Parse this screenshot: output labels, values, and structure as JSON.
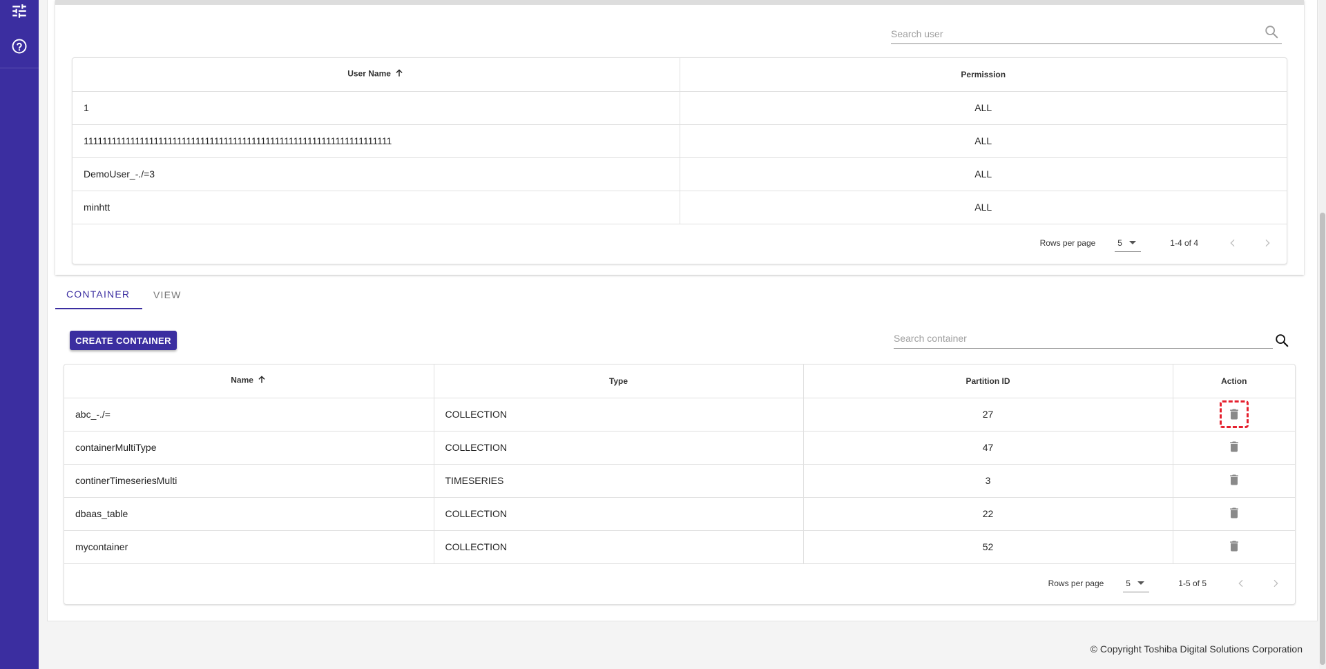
{
  "sidebar": {
    "items": [
      {
        "icon": "tune-icon"
      },
      {
        "icon": "help-icon"
      }
    ]
  },
  "users": {
    "search_placeholder": "Search user",
    "columns": [
      "User Name",
      "Permission"
    ],
    "rows": [
      {
        "name": "1",
        "permission": "ALL"
      },
      {
        "name": "111111111111111111111111111111111111111111111111111111111111111111",
        "permission": "ALL"
      },
      {
        "name": "DemoUser_-./=3",
        "permission": "ALL"
      },
      {
        "name": "minhtt",
        "permission": "ALL"
      }
    ],
    "pagination": {
      "rows_per_page_label": "Rows per page",
      "rows_per_page": "5",
      "range": "1-4 of 4"
    }
  },
  "tabs": [
    {
      "label": "CONTAINER",
      "active": true
    },
    {
      "label": "VIEW",
      "active": false
    }
  ],
  "containers": {
    "create_label": "CREATE CONTAINER",
    "search_placeholder": "Search container",
    "columns": [
      "Name",
      "Type",
      "Partition ID",
      "Action"
    ],
    "rows": [
      {
        "name": "abc_-./=",
        "type": "COLLECTION",
        "partition": "27"
      },
      {
        "name": "containerMultiType",
        "type": "COLLECTION",
        "partition": "47"
      },
      {
        "name": "continerTimeseriesMulti",
        "type": "TIMESERIES",
        "partition": "3"
      },
      {
        "name": "dbaas_table",
        "type": "COLLECTION",
        "partition": "22"
      },
      {
        "name": "mycontainer",
        "type": "COLLECTION",
        "partition": "52"
      }
    ],
    "pagination": {
      "rows_per_page_label": "Rows per page",
      "rows_per_page": "5",
      "range": "1-5 of 5"
    }
  },
  "footer": {
    "copyright": "© Copyright Toshiba Digital Solutions Corporation"
  },
  "colors": {
    "primary": "#3b2ea0",
    "highlight": "#e5202e"
  }
}
